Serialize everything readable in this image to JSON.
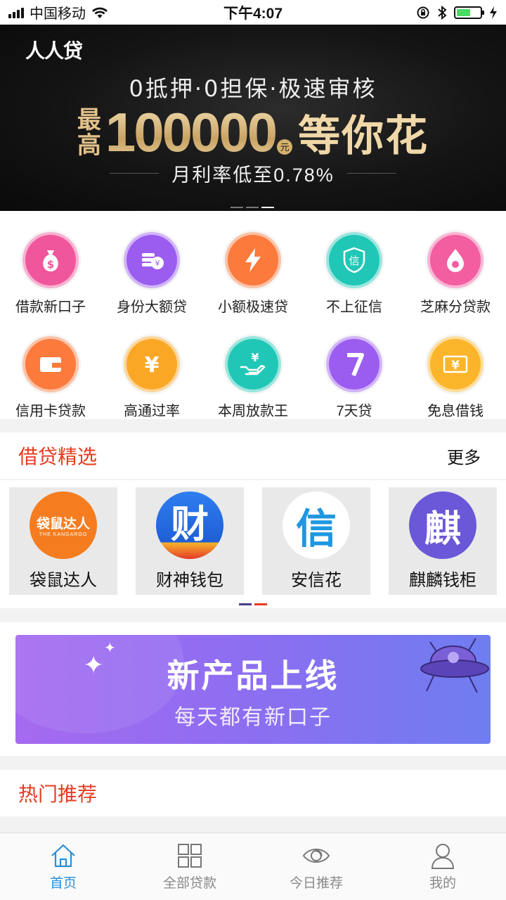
{
  "status_bar": {
    "carrier": "中国移动",
    "time": "下午4:07"
  },
  "banner": {
    "logo": "人人贷",
    "tagline": "0抵押·0担保·极速审核",
    "prefix_top": "最",
    "prefix_bottom": "高",
    "amount": "100000",
    "unit": "元",
    "slogan": "等你花",
    "rate_text": "月利率低至0.78%",
    "slide_count": 3,
    "active_slide": 3
  },
  "categories": {
    "row1": [
      {
        "label": "借款新口子",
        "icon": "money-bag-icon",
        "color": "#f0569b"
      },
      {
        "label": "身份大额贷",
        "icon": "coins-icon",
        "color": "#9b5cf0"
      },
      {
        "label": "小额极速贷",
        "icon": "lightning-icon",
        "color": "#fb7a3c"
      },
      {
        "label": "不上征信",
        "icon": "credit-shield-icon",
        "color": "#21c7b6"
      },
      {
        "label": "芝麻分贷款",
        "icon": "drop-icon",
        "color": "#f25ea0"
      }
    ],
    "row2": [
      {
        "label": "信用卡贷款",
        "icon": "card-icon",
        "color": "#fb7a3c"
      },
      {
        "label": "高通过率",
        "icon": "yen-coin-icon",
        "color": "#fba726"
      },
      {
        "label": "本周放款王",
        "icon": "hand-yen-icon",
        "color": "#21c7b6"
      },
      {
        "label": "7天贷",
        "icon": "seven-icon",
        "color": "#9b5cf0"
      },
      {
        "label": "免息借钱",
        "icon": "yen-bill-icon",
        "color": "#fbb52a"
      }
    ]
  },
  "featured": {
    "title": "借贷精选",
    "more": "更多",
    "items": [
      {
        "name": "袋鼠达人",
        "logo_text": "袋鼠达人",
        "logo_sub": "THE KANGAROO"
      },
      {
        "name": "财神钱包",
        "logo_text": "财"
      },
      {
        "name": "安信花",
        "logo_text": "信"
      },
      {
        "name": "麒麟钱柜",
        "logo_text": "麒"
      }
    ]
  },
  "promo": {
    "title": "新产品上线",
    "subtitle": "每天都有新口子"
  },
  "hot": {
    "title": "热门推荐"
  },
  "tabbar": {
    "tabs": [
      {
        "label": "首页",
        "icon": "home-icon"
      },
      {
        "label": "全部贷款",
        "icon": "grid-icon"
      },
      {
        "label": "今日推荐",
        "icon": "eye-icon"
      },
      {
        "label": "我的",
        "icon": "user-icon"
      }
    ]
  },
  "colors": {
    "accent_red": "#e8391e",
    "tab_active": "#2a8fd8",
    "banner_gold": "#e2c28a"
  }
}
